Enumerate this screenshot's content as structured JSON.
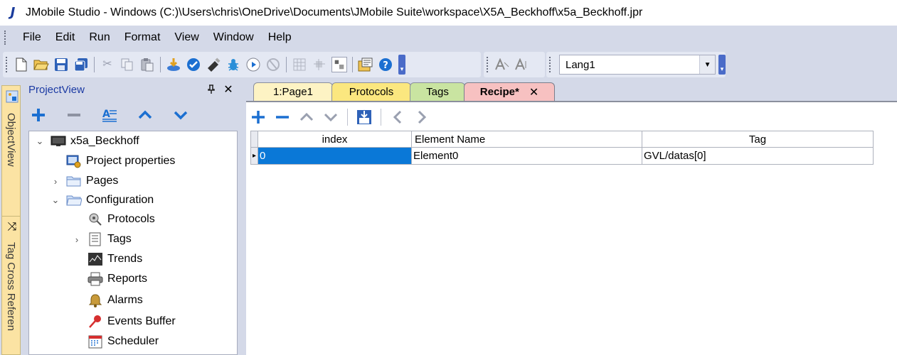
{
  "window": {
    "app_icon": "J",
    "title": "JMobile Studio - Windows (C:)\\Users\\chris\\OneDrive\\Documents\\JMobile Suite\\workspace\\X5A_Beckhoff\\x5a_Beckhoff.jpr"
  },
  "menu": {
    "items": [
      "File",
      "Edit",
      "Run",
      "Format",
      "View",
      "Window",
      "Help"
    ]
  },
  "toolbar": {
    "language": "Lang1"
  },
  "side_tabs": {
    "object_view": "ObjectView",
    "tag_cross_reference": "Tag Cross Referen"
  },
  "project_view": {
    "title": "ProjectView",
    "tree": [
      {
        "label": "x5a_Beckhoff",
        "icon": "monitor-icon",
        "expander": "⌄"
      },
      {
        "label": "Project properties",
        "icon": "project-properties-icon",
        "expander": ""
      },
      {
        "label": "Pages",
        "icon": "folder-icon",
        "expander": "›"
      },
      {
        "label": "Configuration",
        "icon": "folder-icon",
        "expander": "⌄"
      },
      {
        "label": "Protocols",
        "icon": "protocols-icon",
        "expander": ""
      },
      {
        "label": "Tags",
        "icon": "tags-icon",
        "expander": "›"
      },
      {
        "label": "Trends",
        "icon": "trends-icon",
        "expander": ""
      },
      {
        "label": "Reports",
        "icon": "printer-icon",
        "expander": ""
      },
      {
        "label": "Alarms",
        "icon": "bell-icon",
        "expander": ""
      },
      {
        "label": "Events Buffer",
        "icon": "pin-icon",
        "expander": ""
      },
      {
        "label": "Scheduler",
        "icon": "calendar-icon",
        "expander": ""
      }
    ]
  },
  "editor": {
    "tabs": [
      {
        "label": "1:Page1",
        "color": "#fdf3c4"
      },
      {
        "label": "Protocols",
        "color": "#fbe77f"
      },
      {
        "label": "Tags",
        "color": "#c9e4a1"
      },
      {
        "label": "Recipe*",
        "color": "#f7c1c1",
        "active": true,
        "close": "✕"
      }
    ],
    "grid": {
      "columns": [
        "index",
        "Element Name",
        "Tag"
      ],
      "rows": [
        {
          "index": "0",
          "element_name": "Element0",
          "tag": "GVL/datas[0]"
        }
      ]
    }
  },
  "colors": {
    "chrome": "#d4d9e8",
    "accent_blue": "#1b6fd1",
    "selection": "#0a78d7"
  }
}
